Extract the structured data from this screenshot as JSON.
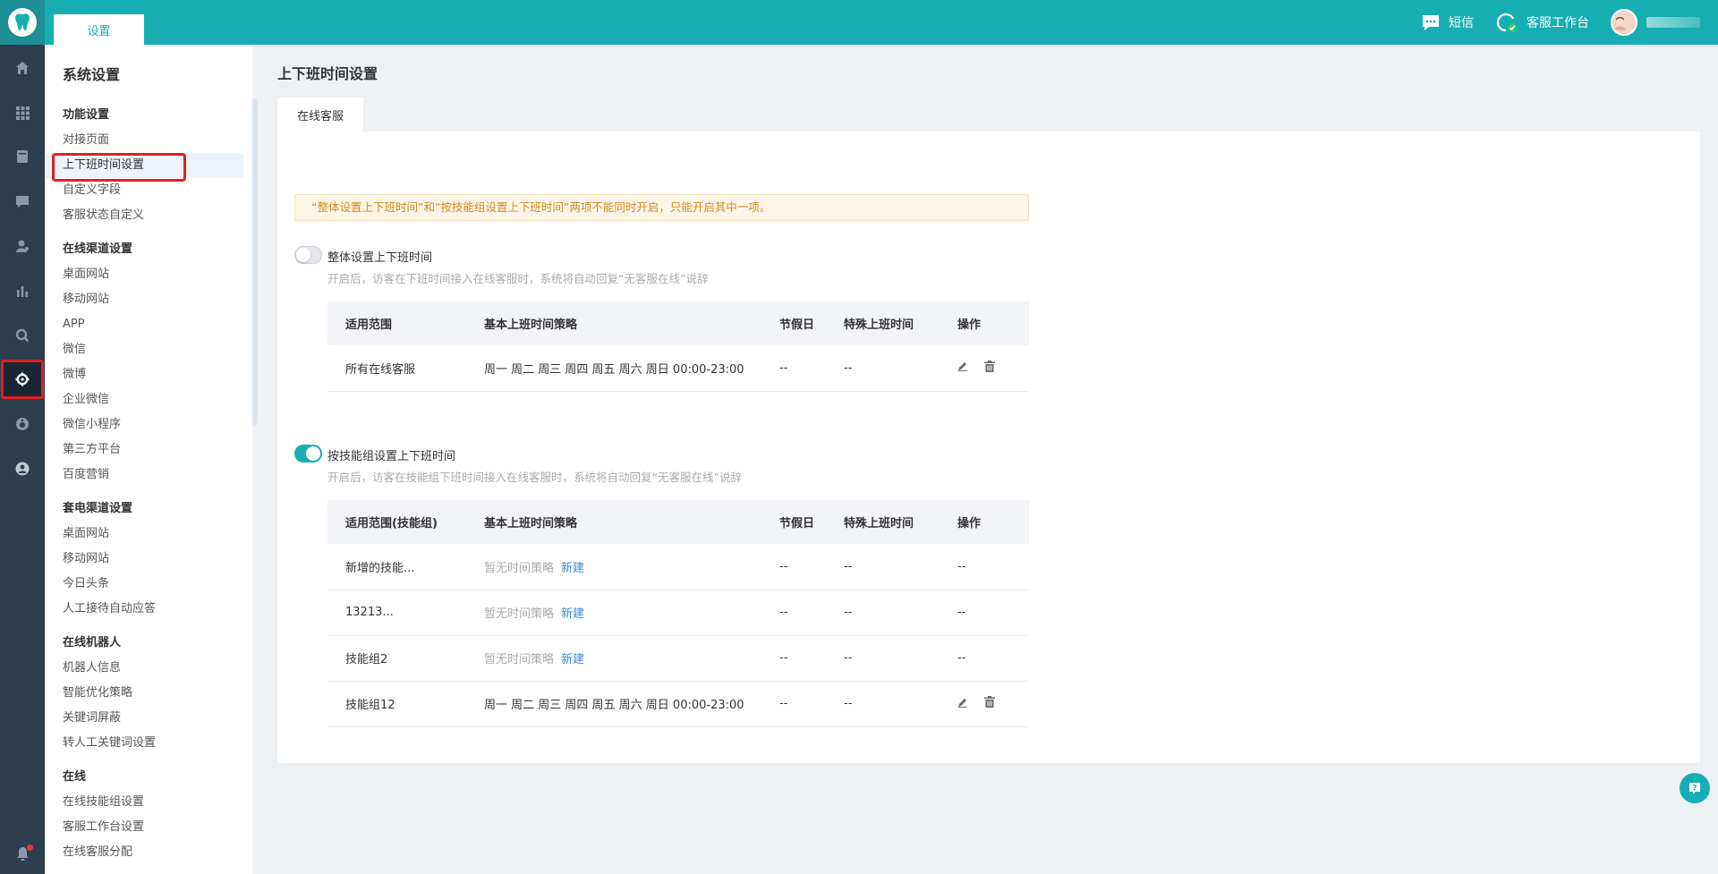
{
  "topbar": {
    "tab": "设置",
    "sms": "短信",
    "workbench": "客服工作台",
    "colors": {
      "brand": "#17aeb3"
    }
  },
  "rail": {
    "icons": [
      "home-icon",
      "apps-grid-icon",
      "document-icon",
      "chat-icon",
      "visitors-icon",
      "stats-icon",
      "search-icon",
      "settings-icon",
      "robot-icon",
      "user-icon",
      "bell-icon"
    ],
    "active": "settings-icon"
  },
  "sidebar": {
    "title": "系统设置",
    "sections": [
      {
        "title": "功能设置",
        "items": [
          "对接页面",
          "上下班时间设置",
          "自定义字段",
          "客服状态自定义"
        ]
      },
      {
        "title": "在线渠道设置",
        "items": [
          "桌面网站",
          "移动网站",
          "APP",
          "微信",
          "微博",
          "企业微信",
          "微信小程序",
          "第三方平台",
          "百度营销"
        ]
      },
      {
        "title": "套电渠道设置",
        "items": [
          "桌面网站",
          "移动网站",
          "今日头条",
          "人工接待自动应答"
        ]
      },
      {
        "title": "在线机器人",
        "items": [
          "机器人信息",
          "智能优化策略",
          "关键词屏蔽",
          "转人工关键词设置"
        ]
      },
      {
        "title": "在线",
        "items": [
          "在线技能组设置",
          "客服工作台设置",
          "在线客服分配"
        ]
      }
    ],
    "active_item": "上下班时间设置"
  },
  "main": {
    "page_title": "上下班时间设置",
    "tab": "在线客服",
    "notice": "“整体设置上下班时间”和“按技能组设置上下班时间”两项不能同时开启，只能开启其中一项。",
    "overall": {
      "label": "整体设置上下班时间",
      "enabled": false,
      "desc": "开启后，访客在下班时间接入在线客服时，系统将自动回复“无客服在线”说辞",
      "headers": [
        "适用范围",
        "基本上班时间策略",
        "节假日",
        "特殊上班时间",
        "操作"
      ],
      "rows": [
        {
          "scope": "所有在线客服",
          "strategy": "周一 周二 周三 周四 周五 周六 周日 00:00-23:00",
          "holiday": "--",
          "special": "--",
          "editable": true
        }
      ]
    },
    "group": {
      "label": "按技能组设置上下班时间",
      "enabled": true,
      "desc": "开启后，访客在技能组下班时间接入在线客服时，系统将自动回复“无客服在线”说辞",
      "headers": [
        "适用范围(技能组)",
        "基本上班时间策略",
        "节假日",
        "特殊上班时间",
        "操作"
      ],
      "no_strategy": "暂无时间策略",
      "new_link": "新建",
      "rows": [
        {
          "scope": "新增的技能...",
          "strategy": "",
          "holiday": "--",
          "special": "--",
          "op": "--",
          "editable": false
        },
        {
          "scope": "13213...",
          "strategy": "",
          "holiday": "--",
          "special": "--",
          "op": "--",
          "editable": false
        },
        {
          "scope": "技能组2",
          "strategy": "",
          "holiday": "--",
          "special": "--",
          "op": "--",
          "editable": false
        },
        {
          "scope": "技能组12",
          "strategy": "周一 周二 周三 周四 周五 周六 周日 00:00-23:00",
          "holiday": "--",
          "special": "--",
          "op": "",
          "editable": true
        }
      ]
    }
  },
  "help": {
    "label": "?"
  }
}
